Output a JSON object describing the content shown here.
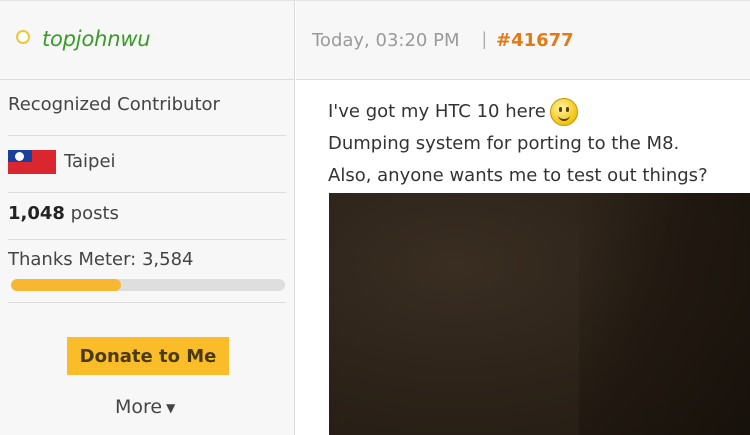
{
  "user": {
    "name": "topjohnwu",
    "title": "Recognized Contributor",
    "location": "Taipei",
    "posts_count": "1,048",
    "posts_label": "posts",
    "thanks_label": "Thanks Meter: 3,584",
    "thanks_meter_fill": 0.4
  },
  "post": {
    "date": "Today, 03:20 PM",
    "separator": "|",
    "number": "#41677",
    "lines": [
      "I've got my HTC 10 here",
      "Dumping system for porting to the M8.",
      "Also, anyone wants me to test out things?"
    ]
  },
  "actions": {
    "donate_label": "Donate to Me",
    "more_label": "More"
  },
  "icons": {
    "status": "status-circle-icon",
    "flag": "taiwan-flag-icon",
    "smiley": "smiley-icon",
    "more_caret": "caret-down-icon"
  },
  "colors": {
    "username": "#3a9a2a",
    "post_number": "#e07b17",
    "donate_button": "#fbbc29",
    "meter_fill": "#f7b733"
  }
}
